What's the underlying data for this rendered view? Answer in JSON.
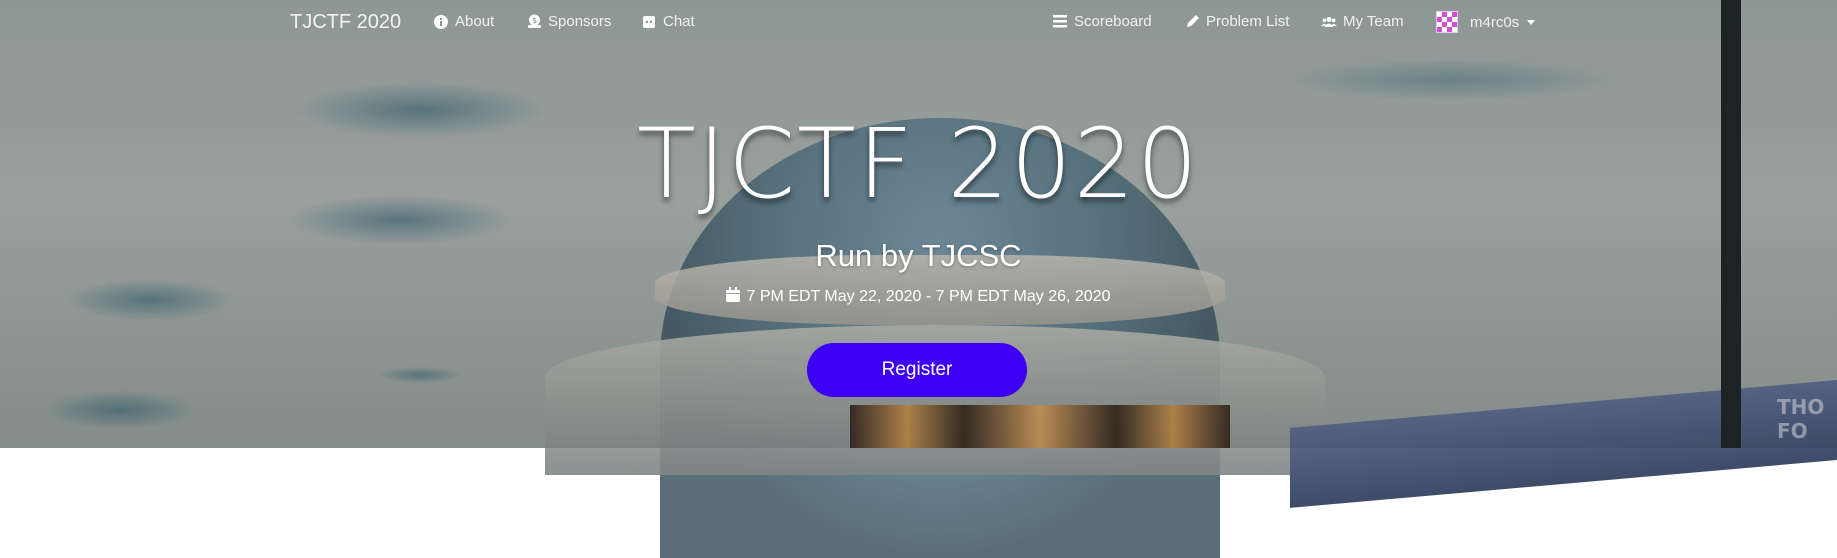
{
  "navbar": {
    "brand": "TJCTF 2020",
    "left_items": [
      {
        "label": "About",
        "icon": "info-icon"
      },
      {
        "label": "Sponsors",
        "icon": "sponsors-icon"
      },
      {
        "label": "Chat",
        "icon": "discord-icon"
      }
    ],
    "right_items": [
      {
        "label": "Scoreboard",
        "icon": "list-icon"
      },
      {
        "label": "Problem List",
        "icon": "pencil-icon"
      },
      {
        "label": "My Team",
        "icon": "users-icon"
      }
    ],
    "user": {
      "name": "m4rc0s",
      "icon": "avatar"
    }
  },
  "hero": {
    "title": "TJCTF 2020",
    "subtitle": "Run by TJCSC",
    "dates": "7 PM EDT May 22, 2020 - 7 PM EDT May 26, 2020",
    "register_label": "Register"
  },
  "background": {
    "building_text": "THO FO"
  },
  "colors": {
    "register": "#3d00f5",
    "text": "#ffffff"
  }
}
